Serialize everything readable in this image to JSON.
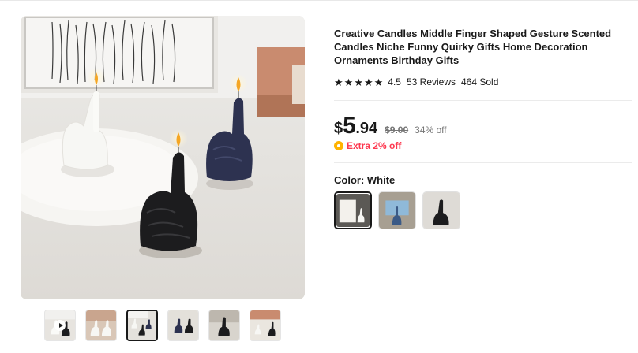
{
  "product": {
    "title": "Creative Candles Middle Finger Shaped Gesture Scented Candles Niche Funny Quirky Gifts Home Decoration Ornaments Birthday Gifts",
    "rating": {
      "stars_filled": 5,
      "value": "4.5",
      "reviews": "53 Reviews",
      "sold": "464 Sold"
    },
    "price": {
      "currency": "$",
      "integer": "5",
      "decimal": ".94",
      "original": "$9.00",
      "discount": "34% off"
    },
    "extra_discount": "Extra 2% off",
    "color": {
      "label": "Color: White",
      "options": [
        "White",
        "Blue",
        "Black"
      ],
      "selected": "White"
    }
  },
  "gallery": {
    "thumbnails": [
      "video",
      "white-hands",
      "three-candles",
      "blue-black",
      "black-hand",
      "lifestyle"
    ],
    "selected_index": 2
  },
  "colors": {
    "text": "#191919",
    "muted": "#757575",
    "sale_red": "#fd384f",
    "coin_yellow": "#ffb300"
  }
}
